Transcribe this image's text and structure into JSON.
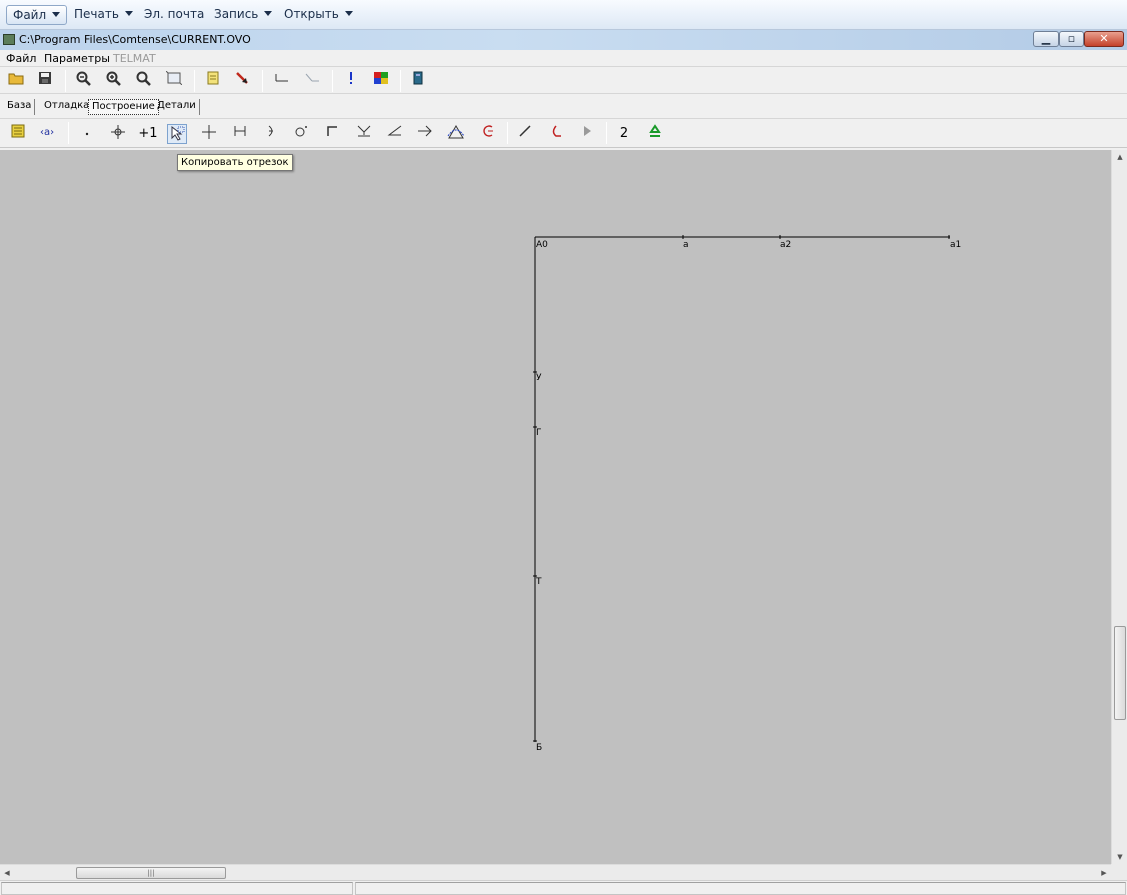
{
  "top_menu": [
    {
      "label": "Файл",
      "caret": true
    },
    {
      "label": "Печать",
      "caret": true
    },
    {
      "label": "Эл. почта",
      "caret": false
    },
    {
      "label": "Запись",
      "caret": true
    },
    {
      "label": "Открыть",
      "caret": true
    }
  ],
  "window": {
    "title": "C:\\Program Files\\Comtense\\CURRENT.OVO",
    "icons": [
      "app-icon",
      "minimize-icon",
      "maximize-icon",
      "close-icon"
    ]
  },
  "app_menu": [
    {
      "label": "Файл",
      "enabled": true
    },
    {
      "label": "Параметры",
      "enabled": true
    },
    {
      "label": "TELMAT",
      "enabled": false
    }
  ],
  "tabs": [
    {
      "label": "База",
      "active": false
    },
    {
      "label": "Отладка",
      "active": false
    },
    {
      "label": "Построение",
      "active": true
    },
    {
      "label": "Детали",
      "active": false
    }
  ],
  "toolbar2_text": {
    "plus_one": "+1",
    "two": "2"
  },
  "tooltip": "Копировать отрезок",
  "drawing": {
    "labels": {
      "A0": "A0",
      "a": "a",
      "a2": "a2",
      "a1": "a1",
      "U": "У",
      "G": "Г",
      "T": "Т",
      "B": "Б"
    }
  },
  "colors": {
    "canvas": "#c0c0c0",
    "line": "#000000",
    "tooltip_bg": "#ffffe1"
  }
}
